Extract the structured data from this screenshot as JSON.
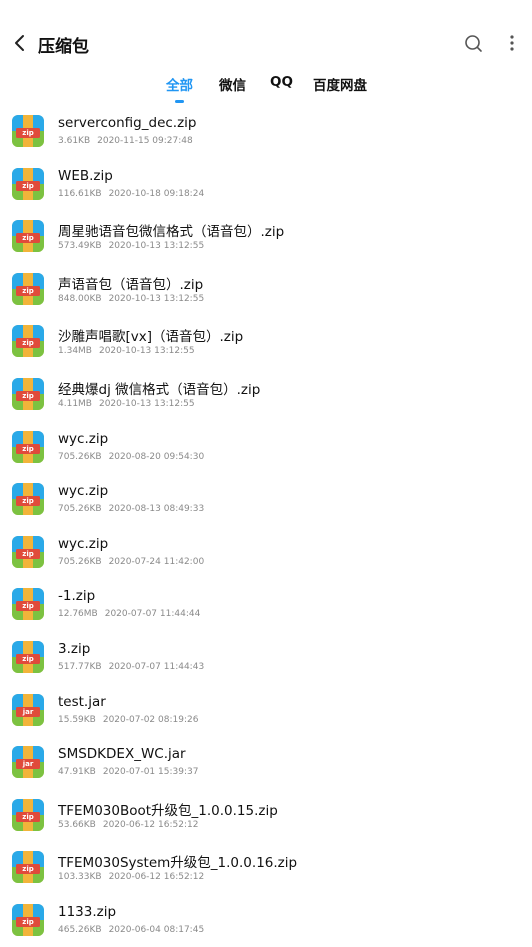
{
  "header": {
    "title": "压缩包"
  },
  "tabs": [
    {
      "label": "全部",
      "active": true
    },
    {
      "label": "微信",
      "active": false
    },
    {
      "label": "QQ",
      "active": false
    },
    {
      "label": "百度网盘",
      "active": false
    }
  ],
  "colors": {
    "accent": "#2196f3"
  },
  "files": [
    {
      "name": "serverconfig_dec.zip",
      "size": "3.61KB",
      "date": "2020-11-15 09:27:48",
      "type": "zip"
    },
    {
      "name": "WEB.zip",
      "size": "116.61KB",
      "date": "2020-10-18 09:18:24",
      "type": "zip"
    },
    {
      "name": "周星驰语音包微信格式（语音包）.zip",
      "size": "573.49KB",
      "date": "2020-10-13 13:12:55",
      "type": "zip"
    },
    {
      "name": "声语音包（语音包）.zip",
      "size": "848.00KB",
      "date": "2020-10-13 13:12:55",
      "type": "zip"
    },
    {
      "name": "沙雕声唱歌[vx]（语音包）.zip",
      "size": "1.34MB",
      "date": "2020-10-13 13:12:55",
      "type": "zip"
    },
    {
      "name": "经典爆dj 微信格式（语音包）.zip",
      "size": "4.11MB",
      "date": "2020-10-13 13:12:55",
      "type": "zip"
    },
    {
      "name": "wyc.zip",
      "size": "705.26KB",
      "date": "2020-08-20 09:54:30",
      "type": "zip"
    },
    {
      "name": "wyc.zip",
      "size": "705.26KB",
      "date": "2020-08-13 08:49:33",
      "type": "zip"
    },
    {
      "name": "wyc.zip",
      "size": "705.26KB",
      "date": "2020-07-24 11:42:00",
      "type": "zip"
    },
    {
      "name": "-1.zip",
      "size": "12.76MB",
      "date": "2020-07-07 11:44:44",
      "type": "zip"
    },
    {
      "name": "3.zip",
      "size": "517.77KB",
      "date": "2020-07-07 11:44:43",
      "type": "zip"
    },
    {
      "name": "test.jar",
      "size": "15.59KB",
      "date": "2020-07-02 08:19:26",
      "type": "jar"
    },
    {
      "name": "SMSDKDEX_WC.jar",
      "size": "47.91KB",
      "date": "2020-07-01 15:39:37",
      "type": "jar"
    },
    {
      "name": "TFEM030Boot升级包_1.0.0.15.zip",
      "size": "53.66KB",
      "date": "2020-06-12 16:52:12",
      "type": "zip"
    },
    {
      "name": "TFEM030System升级包_1.0.0.16.zip",
      "size": "103.33KB",
      "date": "2020-06-12 16:52:12",
      "type": "zip"
    },
    {
      "name": "1133.zip",
      "size": "465.26KB",
      "date": "2020-06-04 08:17:45",
      "type": "zip"
    }
  ]
}
